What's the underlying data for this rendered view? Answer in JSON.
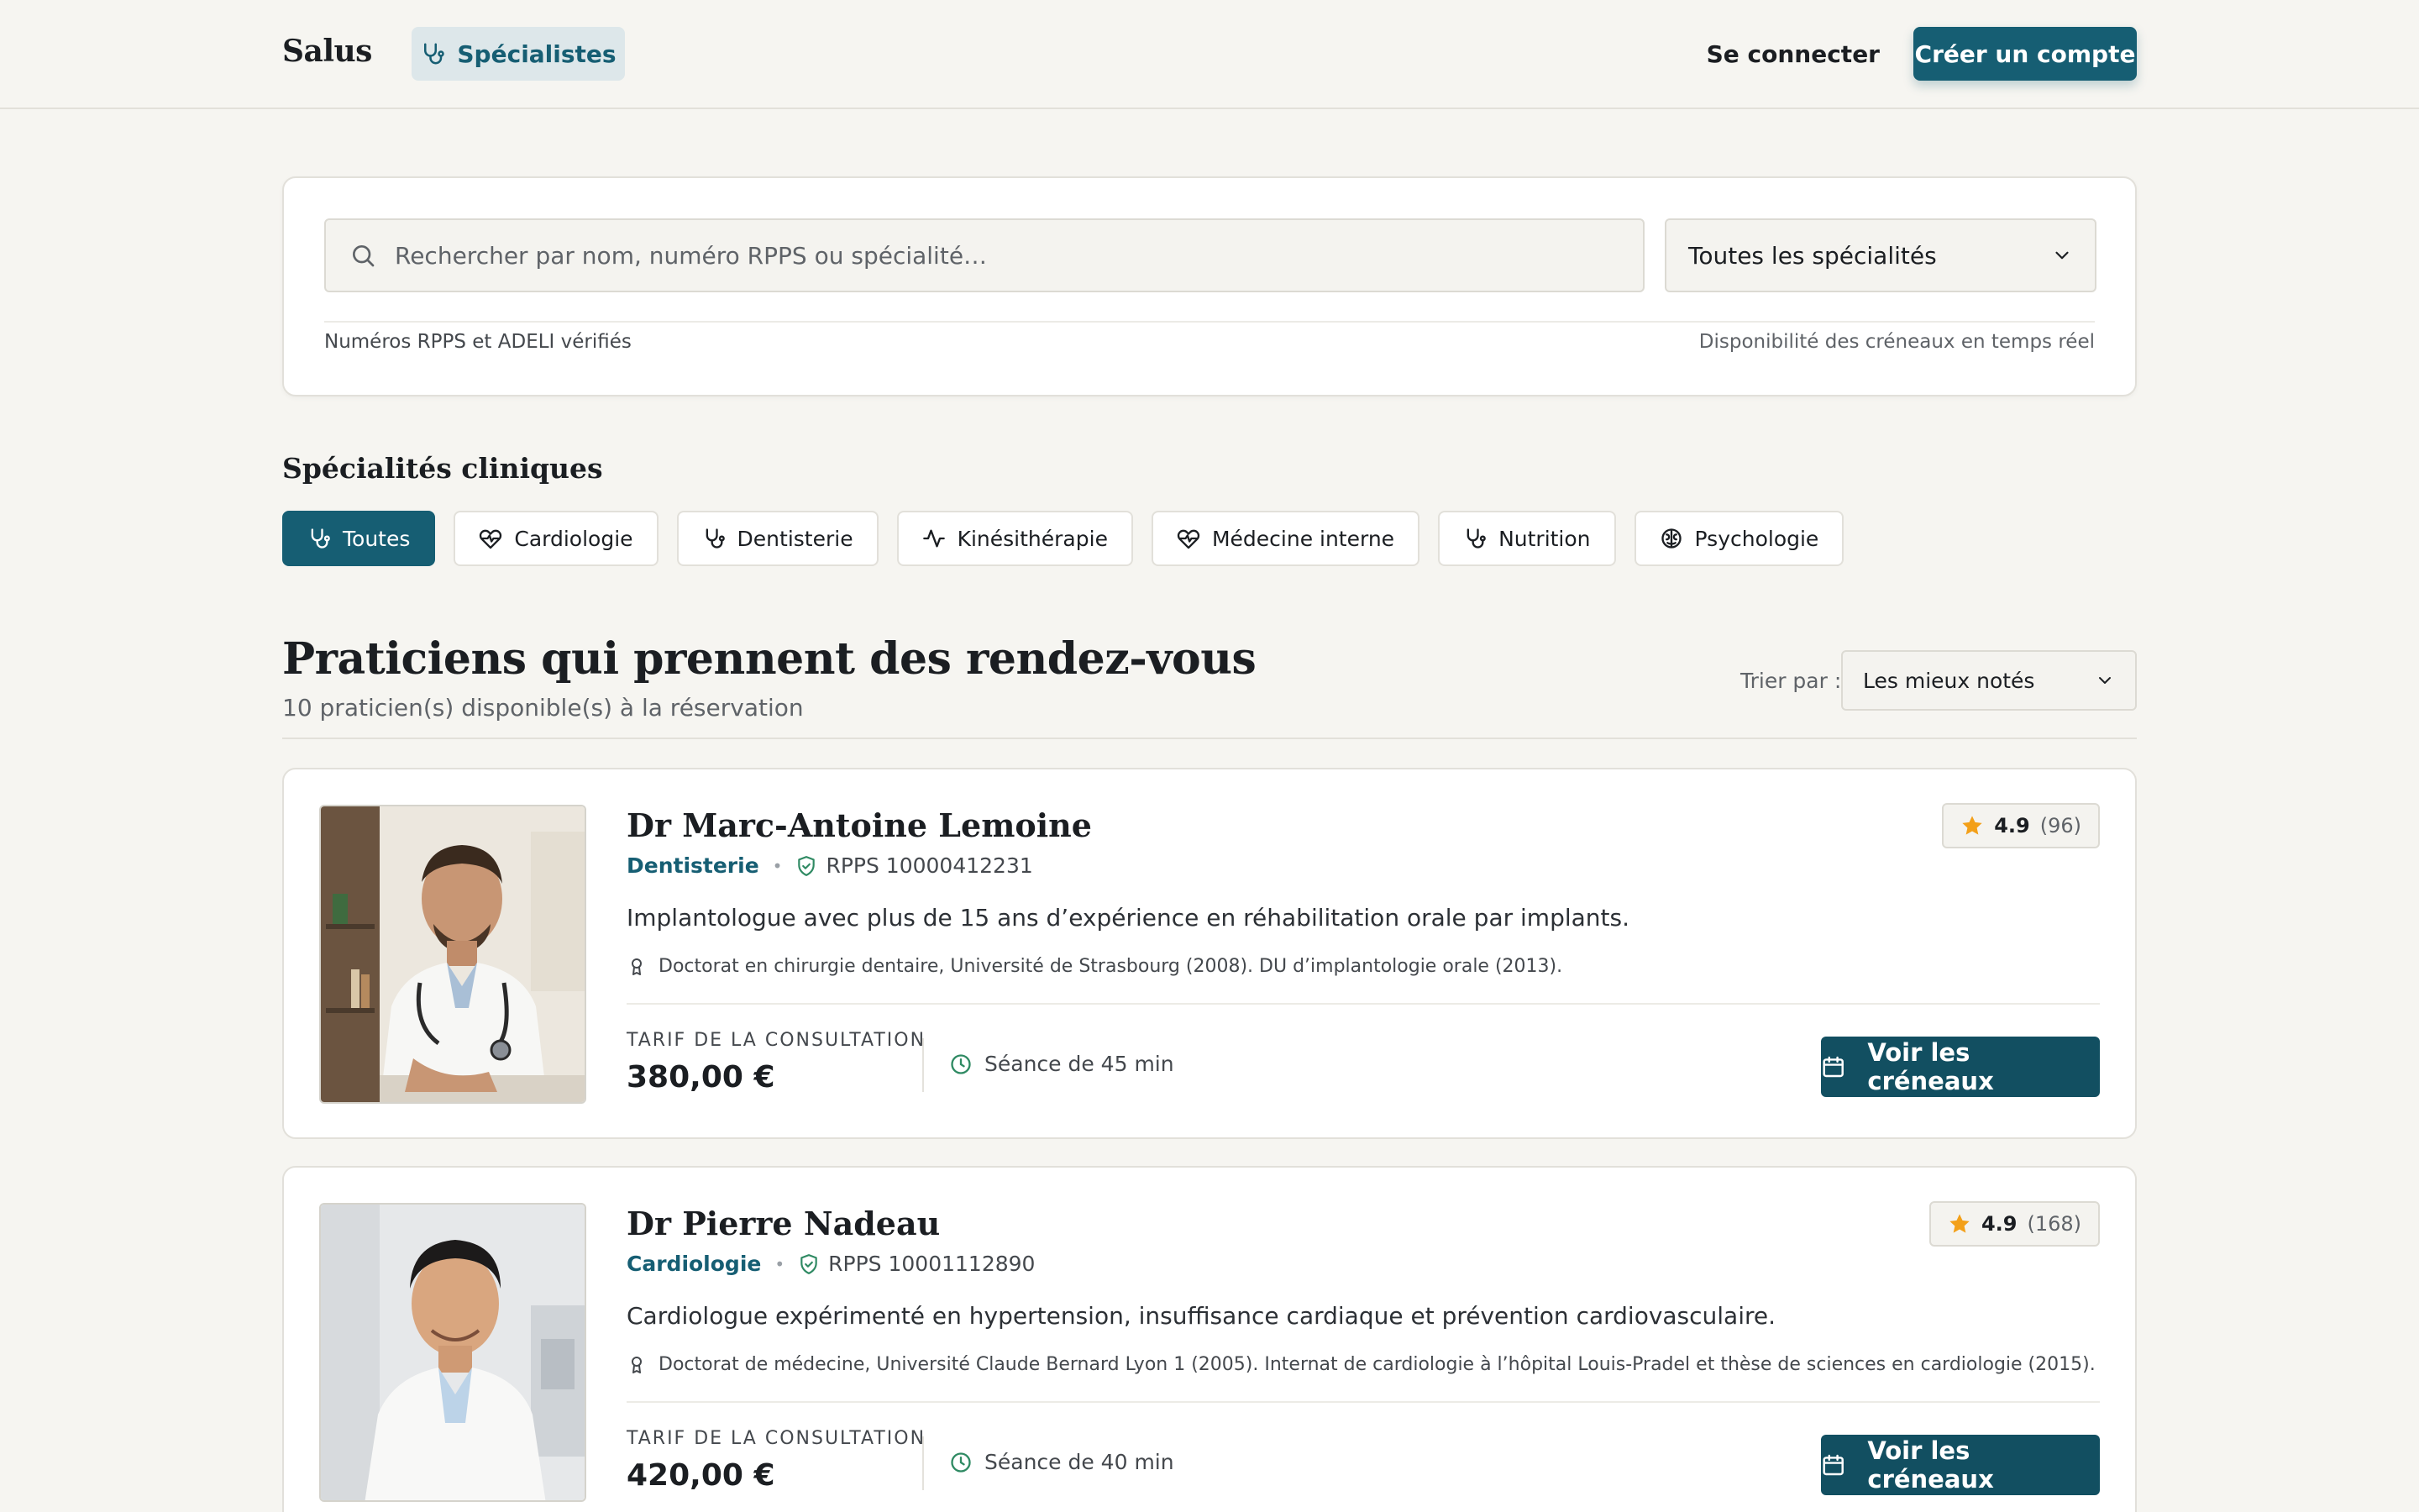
{
  "header": {
    "brand": "Salus",
    "nav_specialists": "Spécialistes",
    "login": "Se connecter",
    "signup": "Créer un compte"
  },
  "search": {
    "placeholder": "Rechercher par nom, numéro RPPS ou spécialité…",
    "specialty_select": "Toutes les spécialités",
    "verified_note": "Numéros RPPS et ADELI vérifiés",
    "realtime_note": "Disponibilité des créneaux en temps réel"
  },
  "specialties": {
    "title": "Spécialités cliniques",
    "chips": [
      {
        "label": "Toutes",
        "icon": "stethoscope-icon",
        "active": true
      },
      {
        "label": "Cardiologie",
        "icon": "heart-pulse-icon",
        "active": false
      },
      {
        "label": "Dentisterie",
        "icon": "stethoscope-icon",
        "active": false
      },
      {
        "label": "Kinésithérapie",
        "icon": "activity-icon",
        "active": false
      },
      {
        "label": "Médecine interne",
        "icon": "heart-pulse-icon",
        "active": false
      },
      {
        "label": "Nutrition",
        "icon": "stethoscope-icon",
        "active": false
      },
      {
        "label": "Psychologie",
        "icon": "brain-icon",
        "active": false
      }
    ]
  },
  "results": {
    "title": "Praticiens qui prennent des rendez-vous",
    "subtitle": "10 praticien(s) disponible(s) à la réservation",
    "sort_label": "Trier par :",
    "sort_value": "Les mieux notés"
  },
  "doctors": [
    {
      "name": "Dr Marc-Antoine Lemoine",
      "specialty": "Dentisterie",
      "rpps": "RPPS 10000412231",
      "description": "Implantologue avec plus de 15 ans d’expérience en réhabilitation orale par implants.",
      "education": "Doctorat en chirurgie dentaire, Université de Strasbourg (2008). DU d’implantologie orale (2013).",
      "fee_label": "TARIF DE LA CONSULTATION",
      "fee": "380,00 €",
      "duration": "Séance de 45 min",
      "rating": "4.9",
      "reviews": "(96)",
      "cta": "Voir les créneaux"
    },
    {
      "name": "Dr Pierre Nadeau",
      "specialty": "Cardiologie",
      "rpps": "RPPS 10001112890",
      "description": "Cardiologue expérimenté en hypertension, insuffisance cardiaque et prévention cardiovasculaire.",
      "education": "Doctorat de médecine, Université Claude Bernard Lyon 1 (2005). Internat de cardiologie à l’hôpital Louis-Pradel et thèse de sciences en cardiologie (2015).",
      "fee_label": "TARIF DE LA CONSULTATION",
      "fee": "420,00 €",
      "duration": "Séance de 40 min",
      "rating": "4.9",
      "reviews": "(168)",
      "cta": "Voir les créneaux"
    }
  ],
  "colors": {
    "accent": "#165e73",
    "background": "#f6f5f1",
    "star": "#f3a019",
    "verified": "#2f8a63"
  }
}
